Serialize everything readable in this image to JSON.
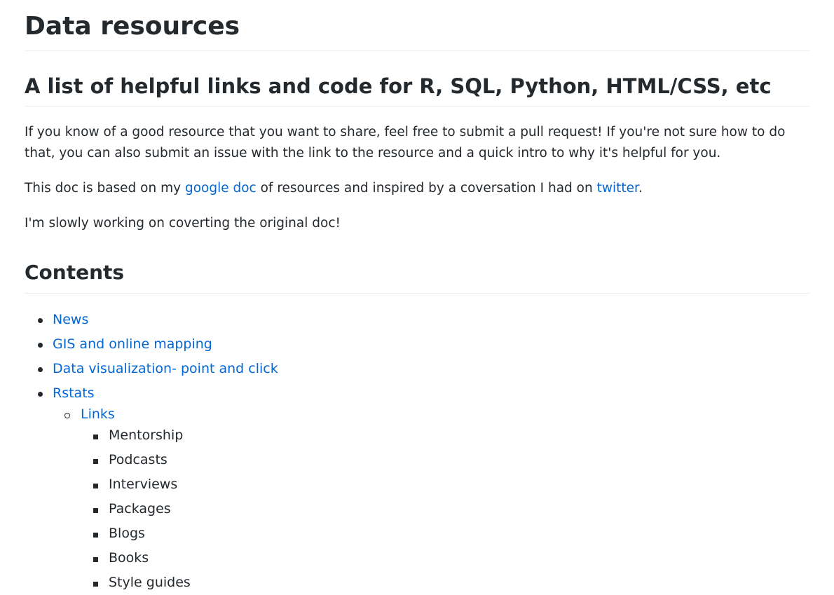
{
  "page_title": "Data resources",
  "subtitle": "A list of helpful links and code for R, SQL, Python, HTML/CSS, etc",
  "intro": "If you know of a good resource that you want to share, feel free to submit a pull request! If you're not sure how to do that, you can also submit an issue with the link to the resource and a quick intro to why it's helpful for you.",
  "based_on": {
    "before": "This doc is based on my ",
    "link1": "google doc",
    "middle": " of resources and inspired by a coversation I had on ",
    "link2": "twitter",
    "after": "."
  },
  "status_note": "I'm slowly working on coverting the original doc!",
  "contents_heading": "Contents",
  "contents": {
    "news": "News",
    "gis": "GIS and online mapping",
    "dataviz": "Data visualization- point and click",
    "rstats": "Rstats",
    "links": "Links",
    "sub_items": [
      "Mentorship",
      "Podcasts",
      "Interviews",
      "Packages",
      "Blogs",
      "Books",
      "Style guides"
    ]
  }
}
